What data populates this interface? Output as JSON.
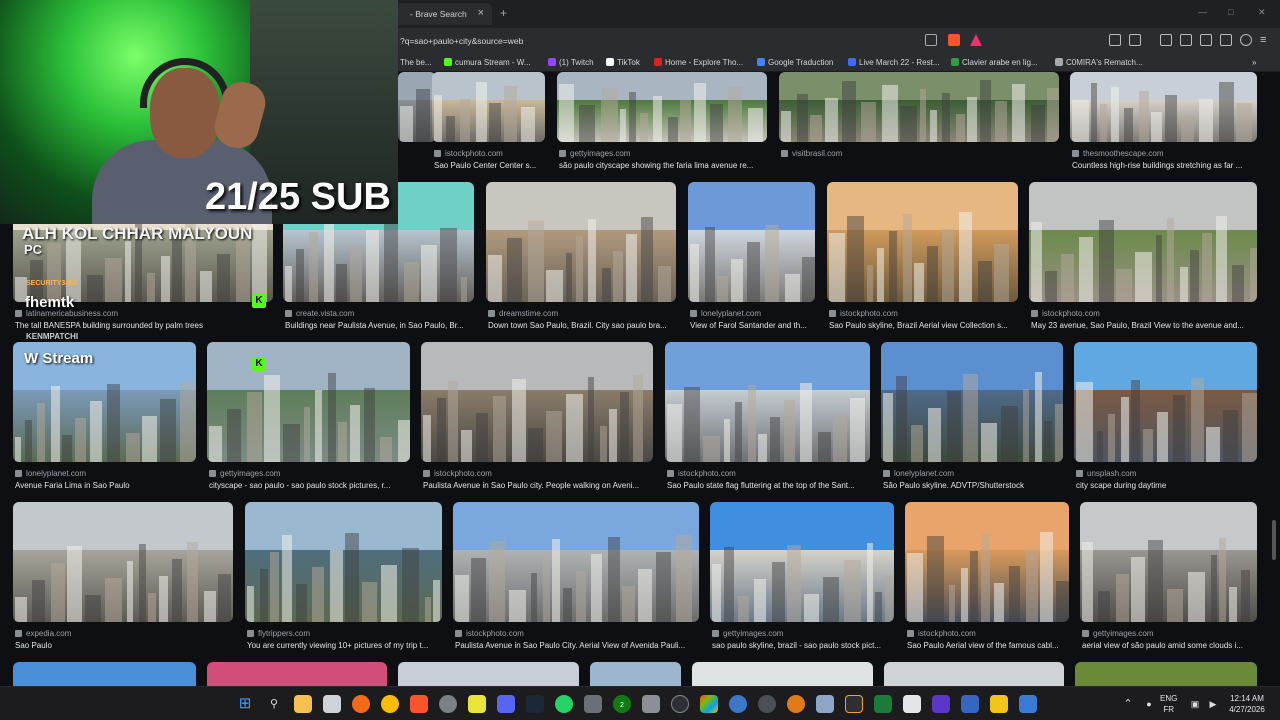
{
  "browser": {
    "tab_title": "- Brave Search",
    "tab_close": "×",
    "new_tab": "+",
    "url": "?q=sao+paulo+city&source=web",
    "bookmarks": [
      {
        "label": "The be...",
        "color": "#888888"
      },
      {
        "label": "cumura Stream - W...",
        "color": "#53fc18"
      },
      {
        "label": "(1) Twitch",
        "color": "#9146ff"
      },
      {
        "label": "TikTok",
        "color": "#ffffff"
      },
      {
        "label": "Home - Explore Tho...",
        "color": "#e02020"
      },
      {
        "label": "Google Traduction",
        "color": "#4285f4"
      },
      {
        "label": "Live March 22 - Rest...",
        "color": "#3d6bff"
      },
      {
        "label": "Clavier arabe en lig...",
        "color": "#2ea043"
      },
      {
        "label": "C0MIRA's Rematch...",
        "color": "#aaaaaa"
      }
    ],
    "bookmarks_more": "»"
  },
  "results": [
    {
      "source": "istockphoto.com",
      "caption": "Sao Paulo Center Center s...",
      "c1": "#c9b89a",
      "c2": "#6d6b66",
      "sky": "#b9c3cc"
    },
    {
      "source": "gettyimages.com",
      "caption": "são paulo cityscape showing the faria lima avenue re...",
      "c1": "#4f7a3e",
      "c2": "#c7c3bb",
      "sky": "#a9b6c2"
    },
    {
      "source": "visitbrasil.com",
      "caption": "",
      "c1": "#3b5e35",
      "c2": "#8a8576",
      "sky": "#7a8f6a"
    },
    {
      "source": "thesmoothescape.com",
      "caption": "Countless high-rise buildings stretching as far ...",
      "c1": "#d5d0c8",
      "c2": "#7c7a77",
      "sky": "#c9cfd6"
    },
    {
      "source": "latinamericabusiness.com",
      "caption": "The tall BANESPA building surrounded by palm trees",
      "c1": "#9da38d",
      "c2": "#5a5650",
      "sky": "#e8e0cf"
    },
    {
      "source": "create.vista.com",
      "caption": "Buildings near Paulista Avenue, in Sao Paulo, Br...",
      "c1": "#b7c5cf",
      "c2": "#625f5c",
      "sky": "#6fd0c8"
    },
    {
      "source": "dreamstime.com",
      "caption": "Down town Sao Paulo, Brazil. City sao paulo bra...",
      "c1": "#b09a7e",
      "c2": "#6a6258",
      "sky": "#c9c6c0"
    },
    {
      "source": "lonelyplanet.com",
      "caption": "View of Farol Santander and th...",
      "c1": "#cfd6de",
      "c2": "#7b7a78",
      "sky": "#6c9ad8"
    },
    {
      "source": "istockphoto.com",
      "caption": "Sao Paulo skyline, Brazil Aerial view Collection s...",
      "c1": "#d09a5c",
      "c2": "#6d5a3c",
      "sky": "#e6b780"
    },
    {
      "source": "istockphoto.com",
      "caption": "May 23 avenue, Sao Paulo, Brazil View to the avenue and...",
      "c1": "#6c8a4a",
      "c2": "#9a9086",
      "sky": "#c2c4c3"
    },
    {
      "source": "lonelyplanet.com",
      "caption": "Avenue Faria Lima in Sao Paulo",
      "c1": "#7b9ab8",
      "c2": "#5a6a54",
      "sky": "#88b4de"
    },
    {
      "source": "gettyimages.com",
      "caption": "cityscape - sao paulo - sao paulo stock pictures, r...",
      "c1": "#5e7e5a",
      "c2": "#7d8a86",
      "sky": "#9fb3c4"
    },
    {
      "source": "istockphoto.com",
      "caption": "Paulista Avenue in Sao Paulo city. People walking on Aveni...",
      "c1": "#8a7c6a",
      "c2": "#4a4744",
      "sky": "#b7b9bb"
    },
    {
      "source": "istockphoto.com",
      "caption": "Sao Paulo state flag fluttering at the top of the Sant...",
      "c1": "#c5ccd2",
      "c2": "#6c7074",
      "sky": "#6fa0d9"
    },
    {
      "source": "lonelyplanet.com",
      "caption": "São Paulo skyline. ADVTP/Shutterstock",
      "c1": "#4f6a8a",
      "c2": "#3d4a3a",
      "sky": "#5b8fd0"
    },
    {
      "source": "unsplash.com",
      "caption": "city scape during daytime",
      "c1": "#7a5a44",
      "c2": "#4d5562",
      "sky": "#5fa8e2"
    },
    {
      "source": "expedia.com",
      "caption": "Sao Paulo",
      "c1": "#a7a49c",
      "c2": "#5d5a54",
      "sky": "#c3c8cc"
    },
    {
      "source": "flytrippers.com",
      "caption": "You are currently viewing 10+ pictures of my trip t...",
      "c1": "#4e6e7e",
      "c2": "#5d6a50",
      "sky": "#9ab8cf"
    },
    {
      "source": "istockphoto.com",
      "caption": "Paulista Avenue in Sao Paulo City. Aerial View of Avenida Pauli...",
      "c1": "#b0b3b5",
      "c2": "#6b6c6c",
      "sky": "#7aa7de"
    },
    {
      "source": "gettyimages.com",
      "caption": "sao paulo skyline, brazil - sao paulo stock pict...",
      "c1": "#d4d2cb",
      "c2": "#6a7888",
      "sky": "#3f8ee0"
    },
    {
      "source": "istockphoto.com",
      "caption": "Sao Paulo Aerial view of the famous cabl...",
      "c1": "#d99a5a",
      "c2": "#4a4f5c",
      "sky": "#e8a46a"
    },
    {
      "source": "gettyimages.com",
      "caption": "aerial view of são paulo amid some clouds i...",
      "c1": "#9a9690",
      "c2": "#4f4d4a",
      "sky": "#c6c8c9"
    }
  ],
  "bottom_row_colors": [
    "#4a8fd8",
    "#d24d7a",
    "#c9ced6",
    "#9db6cf",
    "#e0e3e6",
    "#cfd2d6",
    "#6a8a3a"
  ],
  "overlay": {
    "sub_count": "21/25 SUB",
    "alert_line1": "ALH KOL CHHAR MALYOUN",
    "alert_line2": "PC",
    "alert_line3": "SECURITY3463",
    "alert_line4": "fhemtk",
    "alert_line5": "KENMPATCHI",
    "alert_line6": "W Stream",
    "kick_glyph": "K"
  },
  "taskbar": {
    "lang_top": "ENG",
    "lang_bottom": "FR",
    "time": "12:14 AM",
    "date": "4/27/2026",
    "whatsapp_badge": "2"
  }
}
